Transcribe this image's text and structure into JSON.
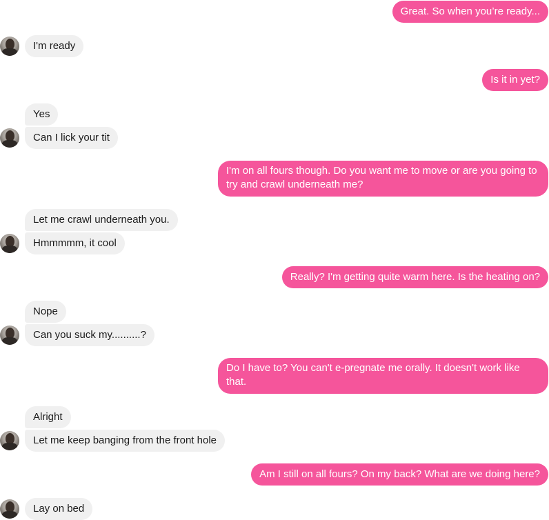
{
  "messages": [
    {
      "from": "me",
      "text": "Great. So when you’re ready..."
    },
    {
      "from": "them",
      "text": "I'm ready"
    },
    {
      "from": "me",
      "text": "Is it in yet?"
    },
    {
      "from": "them",
      "text": "Yes"
    },
    {
      "from": "them",
      "text": "Can I lick your tit"
    },
    {
      "from": "me",
      "text": "I'm on all fours though. Do you want me to move or are you going to try and crawl underneath me?"
    },
    {
      "from": "them",
      "text": "Let me crawl underneath you."
    },
    {
      "from": "them",
      "text": "Hmmmmm, it cool"
    },
    {
      "from": "me",
      "text": "Really? I'm getting quite warm here. Is the heating on?"
    },
    {
      "from": "them",
      "text": "Nope"
    },
    {
      "from": "them",
      "text": "Can you suck my..........?"
    },
    {
      "from": "me",
      "text": "Do I have to? You can't e-pregnate me orally. It doesn't work like that."
    },
    {
      "from": "them",
      "text": "Alright"
    },
    {
      "from": "them",
      "text": "Let me keep banging from the front hole"
    },
    {
      "from": "me",
      "text": "Am I still on all fours? On my back? What are we doing here?"
    },
    {
      "from": "them",
      "text": "Lay on bed"
    }
  ],
  "colors": {
    "outgoing_bubble": "#f5559b",
    "incoming_bubble": "#f0f0f0"
  }
}
